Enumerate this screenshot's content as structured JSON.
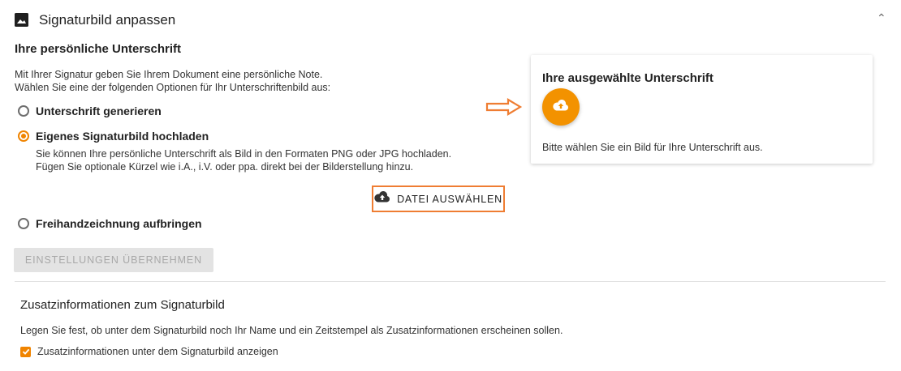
{
  "header": {
    "title": "Signaturbild anpassen",
    "icon": "image-icon",
    "collapse_icon": "chevron-up-icon"
  },
  "personal": {
    "heading": "Ihre persönliche Unterschrift",
    "intro_line1": "Mit Ihrer Signatur geben Sie Ihrem Dokument eine persönliche Note.",
    "intro_line2": "Wählen Sie eine der folgenden Optionen für Ihr Unterschriftenbild aus:"
  },
  "options": [
    {
      "label": "Unterschrift generieren",
      "selected": false
    },
    {
      "label": "Eigenes Signaturbild hochladen",
      "selected": true
    },
    {
      "label": "Freihandzeichnung aufbringen",
      "selected": false
    }
  ],
  "upload": {
    "desc_line1": "Sie können Ihre persönliche Unterschrift als Bild in den Formaten PNG oder JPG hochladen.",
    "desc_line2": "Fügen Sie optionale Kürzel wie i.A., i.V. oder ppa. direkt bei der Bilderstellung hinzu.",
    "button_label": "DATEI AUSWÄHLEN"
  },
  "apply_button": "EINSTELLUNGEN ÜBERNEHMEN",
  "selected_card": {
    "title": "Ihre ausgewählte Unterschrift",
    "message": "Bitte wählen Sie ein Bild für Ihre Unterschrift aus."
  },
  "extra": {
    "heading": "Zusatzinformationen zum Signaturbild",
    "desc": "Legen Sie fest, ob unter dem Signaturbild noch Ihr Name und ein Zeitstempel als Zusatzinformationen erscheinen sollen.",
    "checkbox_label": "Zusatzinformationen unter dem Signaturbild anzeigen",
    "checked": true
  },
  "colors": {
    "accent": "#f08400",
    "highlight": "#ef7d32",
    "fab": "#f39200"
  }
}
